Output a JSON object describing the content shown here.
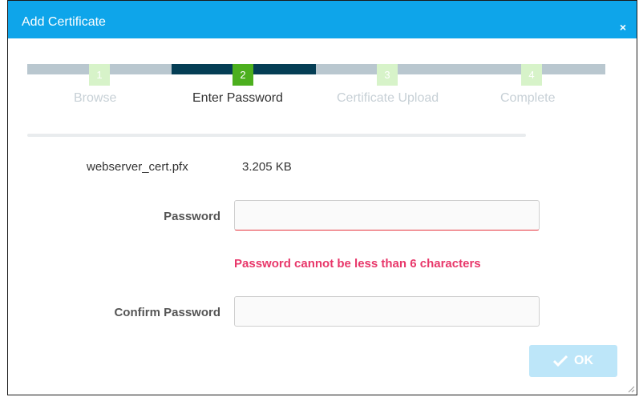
{
  "dialog": {
    "title": "Add Certificate",
    "close_icon": "×",
    "steps": [
      {
        "number": "1",
        "label": "Browse"
      },
      {
        "number": "2",
        "label": "Enter Password"
      },
      {
        "number": "3",
        "label": "Certificate Upload"
      },
      {
        "number": "4",
        "label": "Complete"
      }
    ],
    "active_step": 2,
    "file": {
      "name": "webserver_cert.pfx",
      "size": "3.205 KB"
    },
    "password": {
      "label": "Password",
      "value": "",
      "error": "Password cannot be less than 6 characters"
    },
    "confirm_password": {
      "label": "Confirm Password",
      "value": ""
    },
    "ok_label": "OK",
    "colors": {
      "accent": "#0ea5ea",
      "active_step": "#053e55",
      "step_done": "#4caf1e",
      "step_inactive": "#b9c7cf",
      "error": "#e8376a"
    }
  }
}
